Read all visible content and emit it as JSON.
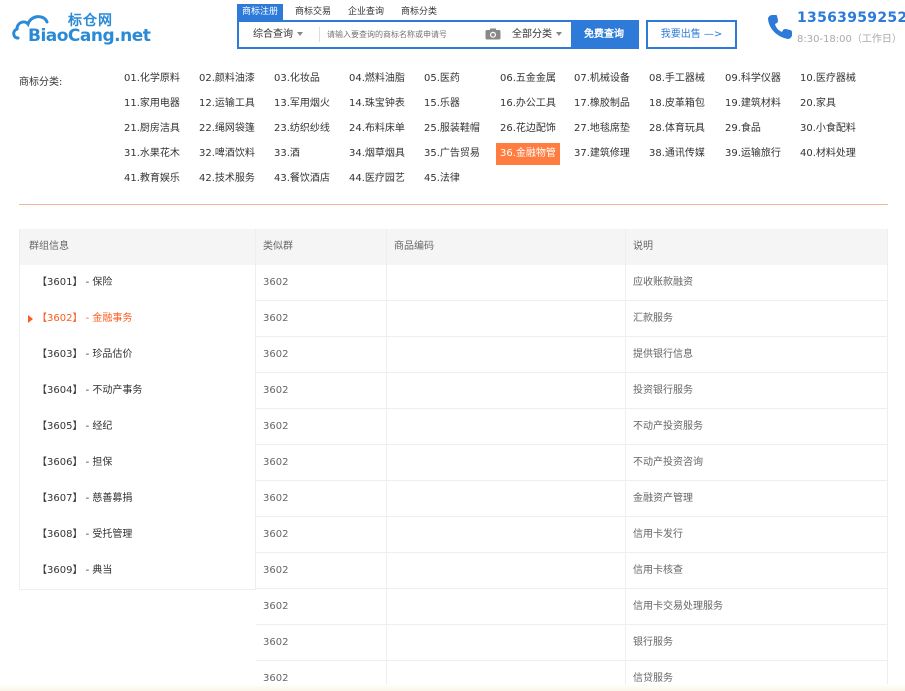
{
  "logo": {
    "cn": "标仓网",
    "en": "BiaoCang.net"
  },
  "search": {
    "tabs": [
      "商标注册",
      "商标交易",
      "企业查询",
      "商标分类"
    ],
    "active_tab": 0,
    "scope": "综合查询",
    "placeholder": "请输入要查询的商标名称或申请号",
    "category": "全部分类",
    "submit": "免费查询"
  },
  "sell_button": "我要出售 —>",
  "contact": {
    "hotline": "13563959252",
    "hours": "8:30-18:00（工作日）"
  },
  "category_label": "商标分类:",
  "categories": [
    "01.化学原料",
    "02.颜料油漆",
    "03.化妆品",
    "04.燃料油脂",
    "05.医药",
    "06.五金金属",
    "07.机械设备",
    "08.手工器械",
    "09.科学仪器",
    "10.医疗器械",
    "11.家用电器",
    "12.运输工具",
    "13.军用烟火",
    "14.珠宝钟表",
    "15.乐器",
    "16.办公工具",
    "17.橡胶制品",
    "18.皮革箱包",
    "19.建筑材料",
    "20.家具",
    "21.厨房洁具",
    "22.绳网袋篷",
    "23.纺织纱线",
    "24.布料床单",
    "25.服装鞋帽",
    "26.花边配饰",
    "27.地毯席垫",
    "28.体育玩具",
    "29.食品",
    "30.小食配料",
    "31.水果花木",
    "32.啤酒饮料",
    "33.酒",
    "34.烟草烟具",
    "35.广告贸易",
    "36.金融物管",
    "37.建筑修理",
    "38.通讯传媒",
    "39.运输旅行",
    "40.材料处理",
    "41.教育娱乐",
    "42.技术服务",
    "43.餐饮酒店",
    "44.医疗园艺",
    "45.法律"
  ],
  "active_category": 35,
  "groups": {
    "header": "群组信息",
    "items": [
      "【3601】 - 保险",
      "【3602】 - 金融事务",
      "【3603】 - 珍品估价",
      "【3604】 - 不动产事务",
      "【3605】 - 经纪",
      "【3606】 - 担保",
      "【3607】 - 慈善募捐",
      "【3608】 - 受托管理",
      "【3609】 - 典当"
    ],
    "active": 1
  },
  "table": {
    "headers": [
      "类似群",
      "商品编码",
      "说明"
    ],
    "rows": [
      [
        "3602",
        "",
        "应收账款融资"
      ],
      [
        "3602",
        "",
        "汇款服务"
      ],
      [
        "3602",
        "",
        "提供银行信息"
      ],
      [
        "3602",
        "",
        "投资银行服务"
      ],
      [
        "3602",
        "",
        "不动产投资服务"
      ],
      [
        "3602",
        "",
        "不动产投资咨询"
      ],
      [
        "3602",
        "",
        "金融资产管理"
      ],
      [
        "3602",
        "",
        "信用卡发行"
      ],
      [
        "3602",
        "",
        "信用卡核查"
      ],
      [
        "3602",
        "",
        "信用卡交易处理服务"
      ],
      [
        "3602",
        "",
        "银行服务"
      ],
      [
        "3602",
        "",
        "信贷服务"
      ]
    ]
  },
  "colors": {
    "brand_blue": "#2e7ad8",
    "accent_orange": "#ff7d40"
  }
}
